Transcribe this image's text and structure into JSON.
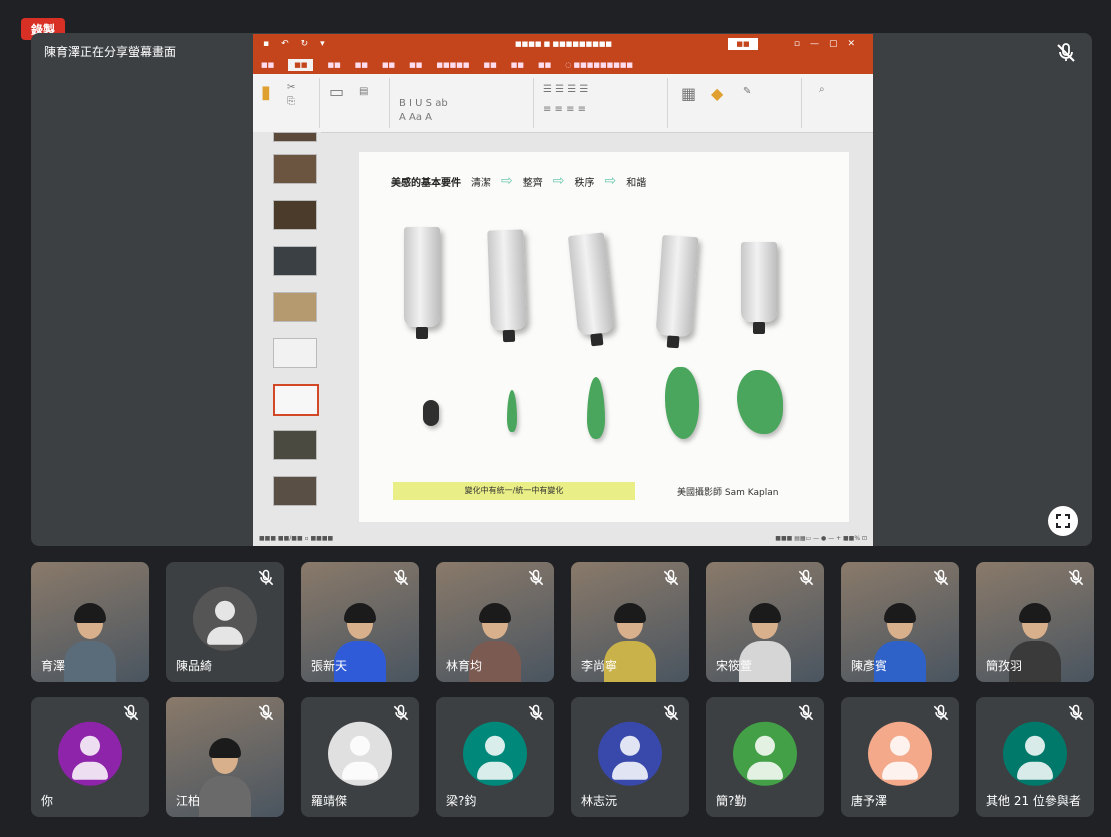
{
  "meeting": {
    "recording_badge": "錄製",
    "presenter_label": "陳育澤正在分享螢幕畫面"
  },
  "slide": {
    "title_items": [
      "美感的基本要件",
      "清潔",
      "整齊",
      "秩序",
      "和諧"
    ],
    "caption": "變化中有統一/統一中有變化",
    "credit": "美國攝影師 Sam Kaplan"
  },
  "participants_row1": [
    {
      "name": "育澤",
      "type": "video",
      "muted": false,
      "shirt": "#5a6b7a"
    },
    {
      "name": "陳品綺",
      "type": "avatar-image",
      "muted": true,
      "shirt": "#c0392b"
    },
    {
      "name": "張新天",
      "type": "video",
      "muted": true,
      "shirt": "#2f5bd8"
    },
    {
      "name": "林育均",
      "type": "video",
      "muted": true,
      "shirt": "#7b5a52"
    },
    {
      "name": "李尚寧",
      "type": "video",
      "muted": true,
      "shirt": "#c9b24a"
    },
    {
      "name": "宋筱萱",
      "type": "video",
      "muted": true,
      "shirt": "#d6d6d6"
    },
    {
      "name": "陳彥賓",
      "type": "video",
      "muted": true,
      "shirt": "#2f62c8"
    },
    {
      "name": "簡孜羽",
      "type": "video",
      "muted": true,
      "shirt": "#3a3a3a"
    }
  ],
  "participants_row2": [
    {
      "name": "你",
      "type": "avatar",
      "muted": true,
      "color": "#8e24aa"
    },
    {
      "name": "江柏",
      "type": "video",
      "muted": true,
      "shirt": "#6a6a6a"
    },
    {
      "name": "羅靖傑",
      "type": "avatar-image",
      "muted": true,
      "color": "#e0e0e0"
    },
    {
      "name": "梁?鈞",
      "type": "avatar",
      "muted": true,
      "color": "#00897b"
    },
    {
      "name": "林志沅",
      "type": "avatar-image",
      "muted": true,
      "color": "#3949ab"
    },
    {
      "name": "簡?勤",
      "type": "avatar",
      "muted": true,
      "color": "#43a047"
    },
    {
      "name": "唐予澤",
      "type": "avatar-image",
      "muted": true,
      "color": "#f4a98a"
    },
    {
      "name": "其他 21 位參與者",
      "type": "avatar",
      "muted": true,
      "color": "#00796b"
    }
  ]
}
